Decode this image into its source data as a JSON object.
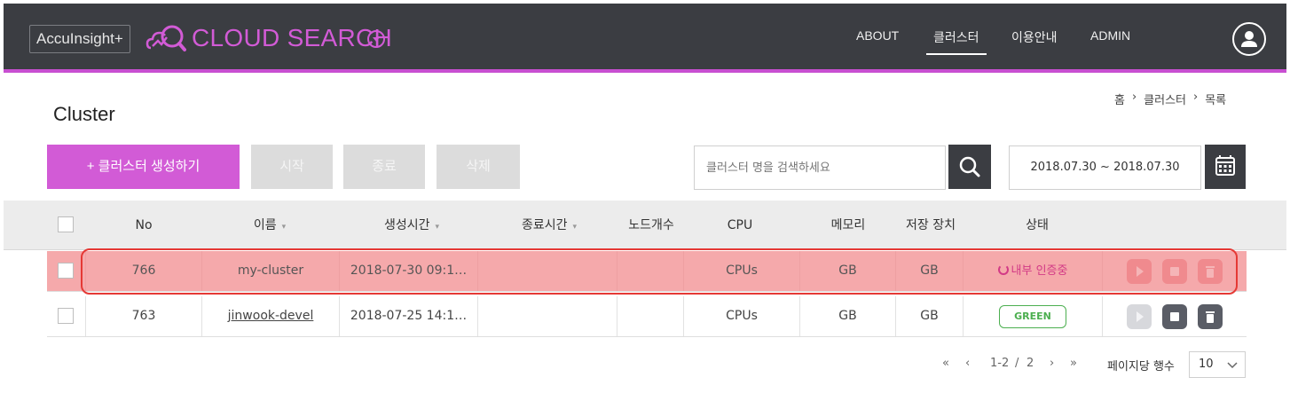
{
  "header": {
    "brand_box": "AccuInsight+",
    "brand_title": "CLOUD SEARCH",
    "nav": [
      "ABOUT",
      "클러스터",
      "이용안내",
      "ADMIN"
    ],
    "active_nav": "클러스터"
  },
  "page": {
    "title": "Cluster",
    "breadcrumb": [
      "홈",
      "클러스터",
      "목록"
    ],
    "breadcrumb_sep": "›"
  },
  "toolbar": {
    "create_label": "+ 클러스터 생성하기",
    "start_label": "시작",
    "stop_label": "종료",
    "delete_label": "삭제",
    "search_placeholder": "클러스터 명을 검색하세요",
    "date_range": "2018.07.30 ~ 2018.07.30"
  },
  "table": {
    "headers": {
      "no": "No",
      "name": "이름",
      "created": "생성시간",
      "ended": "종료시간",
      "nodes": "노드개수",
      "cpu": "CPU",
      "memory": "메모리",
      "storage": "저장 장치",
      "status": "상태",
      "sort_glyph": "▾"
    },
    "rows": [
      {
        "no": "766",
        "name": "my-cluster",
        "created": "2018-07-30 09:1…",
        "ended": "",
        "nodes": "",
        "cpu": "CPUs",
        "memory": "GB",
        "storage": "GB",
        "status": "내부 인증중",
        "status_type": "loading",
        "highlighted": true
      },
      {
        "no": "763",
        "name": "jinwook-devel",
        "created": "2018-07-25 14:1…",
        "ended": "",
        "nodes": "",
        "cpu": "CPUs",
        "memory": "GB",
        "storage": "GB",
        "status": "GREEN",
        "status_type": "green",
        "highlighted": false
      }
    ]
  },
  "pagination": {
    "first": "«",
    "prev": "‹",
    "range": "1-2",
    "sep": "/",
    "total": "2",
    "next": "›",
    "last": "»",
    "rows_label": "페이지당 행수",
    "rows_per_page": "10"
  },
  "colors": {
    "brand": "#d25bd6",
    "topbar": "#3b3d42",
    "highlight": "#f5a9ab",
    "outline": "#e53935",
    "green": "#4caf50"
  }
}
